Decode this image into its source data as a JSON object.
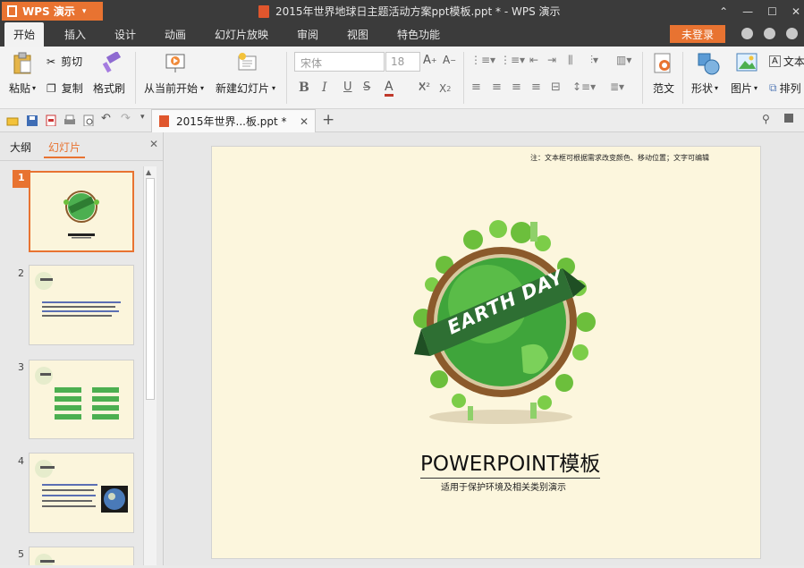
{
  "app": {
    "name": "WPS 演示",
    "window_title": "2015年世界地球日主题活动方案ppt模板.ppt * - WPS 演示"
  },
  "menu": {
    "tabs": [
      "开始",
      "插入",
      "设计",
      "动画",
      "幻灯片放映",
      "审阅",
      "视图",
      "特色功能"
    ],
    "active": "开始",
    "login_label": "未登录"
  },
  "ribbon": {
    "paste": "粘贴",
    "cut": "剪切",
    "copy": "复制",
    "format_painter": "格式刷",
    "from_current": "从当前开始",
    "new_slide": "新建幻灯片",
    "font_name": "宋体",
    "font_size": "18",
    "template": "范文",
    "shape": "形状",
    "picture": "图片",
    "textbox": "文本",
    "arrange": "排列"
  },
  "document_tab": {
    "label": "2015年世界...板.ppt *",
    "add": "+"
  },
  "left_panel": {
    "tab_outline": "大纲",
    "tab_slides": "幻灯片",
    "slide_numbers": [
      "1",
      "2",
      "3",
      "4",
      "5"
    ]
  },
  "slide": {
    "note": "注：文本框可根据需求改变颜色、移动位置；文字可编辑",
    "badge": "EARTH DAY",
    "title": "POWERPOINT模板",
    "subtitle": "适用于保护环境及相关类别演示"
  },
  "colors": {
    "accent": "#e87331",
    "titlebar": "#3b3b3b",
    "slide_bg": "#fcf6dd",
    "earth_green": "#4caf50"
  }
}
